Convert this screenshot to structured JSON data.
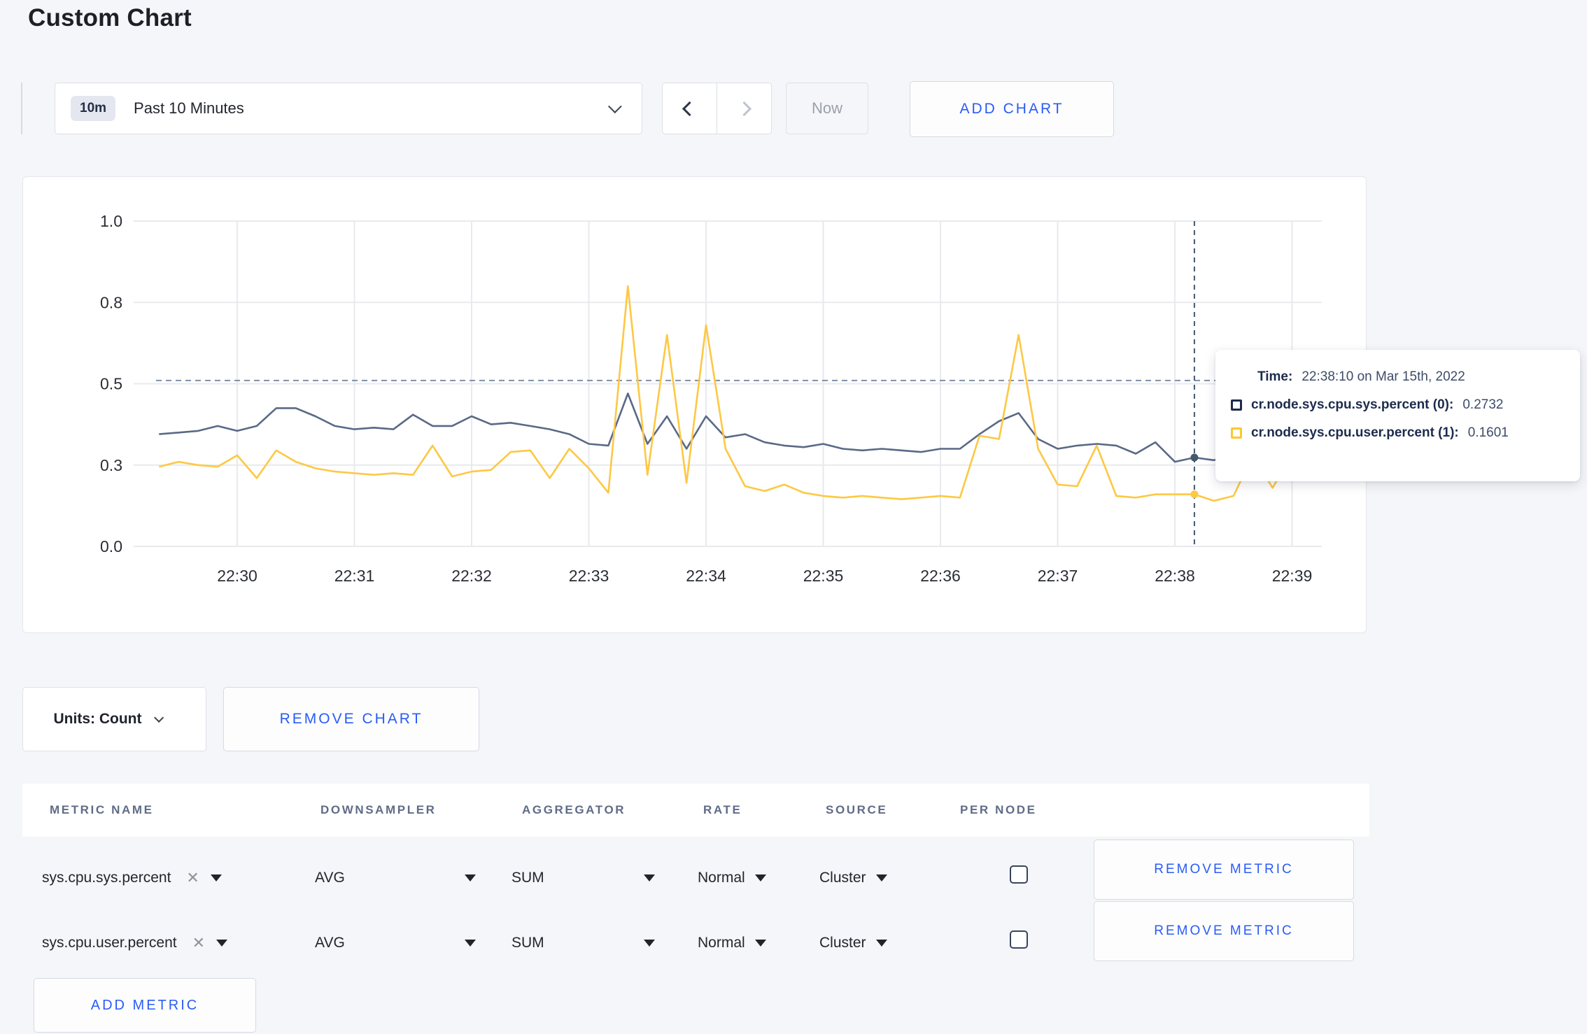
{
  "page": {
    "title": "Custom Chart"
  },
  "colors": {
    "accent_blue": "#2a5cf5",
    "series_sys": "#5a6987",
    "series_user": "#fdc843",
    "swatch_sys": "#1f2b4d",
    "swatch_user": "#fdc830",
    "grid": "#e8eaee",
    "hover_guide": "#44586e",
    "value_guide": "#7e90a8"
  },
  "icons": {
    "clear": "✕",
    "chevron_down": "chevron-down",
    "chevron_left": "chevron-left",
    "chevron_right": "chevron-right",
    "caret_down": "caret-down"
  },
  "toolbar": {
    "time_range_badge": "10m",
    "time_range_label": "Past 10 Minutes",
    "now_label": "Now",
    "add_chart_label": "ADD CHART"
  },
  "chart_controls": {
    "units_label": "Units: Count",
    "remove_chart_label": "REMOVE CHART"
  },
  "tooltip": {
    "time_label": "Time:",
    "time_value": "22:38:10 on Mar 15th, 2022",
    "rows": [
      {
        "label": "cr.node.sys.cpu.sys.percent (0):",
        "value": "0.2732",
        "color": "#1f2b4d"
      },
      {
        "label": "cr.node.sys.cpu.user.percent (1):",
        "value": "0.1601",
        "color": "#fdc830"
      }
    ]
  },
  "chart_data": {
    "type": "line",
    "title": "",
    "x_start": "22:29:20",
    "x_step_seconds": 10,
    "x_tick_labels": [
      "22:30",
      "22:31",
      "22:32",
      "22:33",
      "22:34",
      "22:35",
      "22:36",
      "22:37",
      "22:38",
      "22:39"
    ],
    "y_ticks": [
      {
        "label": "0.0",
        "value": 0
      },
      {
        "label": "0.3",
        "value": 0.25
      },
      {
        "label": "0.5",
        "value": 0.5
      },
      {
        "label": "0.8",
        "value": 0.75
      },
      {
        "label": "1.0",
        "value": 1
      }
    ],
    "ylim": [
      0,
      1
    ],
    "grid": true,
    "legend_position": "tooltip",
    "series": [
      {
        "name": "cr.node.sys.cpu.sys.percent",
        "color": "#5a6987",
        "values": [
          0.345,
          0.35,
          0.355,
          0.37,
          0.355,
          0.37,
          0.425,
          0.425,
          0.4,
          0.37,
          0.36,
          0.365,
          0.36,
          0.405,
          0.37,
          0.37,
          0.4,
          0.375,
          0.38,
          0.37,
          0.36,
          0.345,
          0.315,
          0.31,
          0.47,
          0.315,
          0.4,
          0.3,
          0.4,
          0.335,
          0.345,
          0.32,
          0.31,
          0.305,
          0.315,
          0.3,
          0.295,
          0.3,
          0.295,
          0.29,
          0.3,
          0.3,
          0.345,
          0.385,
          0.41,
          0.33,
          0.3,
          0.31,
          0.315,
          0.31,
          0.285,
          0.32,
          0.26,
          0.2732,
          0.265,
          0.28,
          0.29,
          0.29,
          0.3,
          0.3
        ]
      },
      {
        "name": "cr.node.sys.cpu.user.percent",
        "color": "#fdc843",
        "values": [
          0.245,
          0.26,
          0.25,
          0.245,
          0.28,
          0.21,
          0.295,
          0.26,
          0.24,
          0.23,
          0.225,
          0.22,
          0.225,
          0.22,
          0.31,
          0.215,
          0.23,
          0.235,
          0.29,
          0.295,
          0.21,
          0.3,
          0.24,
          0.165,
          0.8,
          0.22,
          0.65,
          0.195,
          0.68,
          0.3,
          0.185,
          0.17,
          0.19,
          0.165,
          0.155,
          0.15,
          0.155,
          0.15,
          0.145,
          0.15,
          0.155,
          0.15,
          0.34,
          0.33,
          0.65,
          0.3,
          0.19,
          0.185,
          0.31,
          0.155,
          0.15,
          0.16,
          0.16,
          0.1601,
          0.14,
          0.155,
          0.28,
          0.18,
          0.28,
          0.22
        ]
      }
    ],
    "hover": {
      "x_index": 53,
      "x_label": "22:38:10",
      "value_guide_y": 0.51,
      "sys_value": 0.2732,
      "user_value": 0.1601
    }
  },
  "table": {
    "headers": [
      "METRIC NAME",
      "DOWNSAMPLER",
      "AGGREGATOR",
      "RATE",
      "SOURCE",
      "PER NODE"
    ],
    "rows": [
      {
        "metric": "sys.cpu.sys.percent",
        "downsampler": "AVG",
        "aggregator": "SUM",
        "rate": "Normal",
        "source": "Cluster",
        "per_node": false,
        "remove_label": "REMOVE METRIC"
      },
      {
        "metric": "sys.cpu.user.percent",
        "downsampler": "AVG",
        "aggregator": "SUM",
        "rate": "Normal",
        "source": "Cluster",
        "per_node": false,
        "remove_label": "REMOVE METRIC"
      }
    ],
    "add_metric_label": "ADD METRIC"
  }
}
